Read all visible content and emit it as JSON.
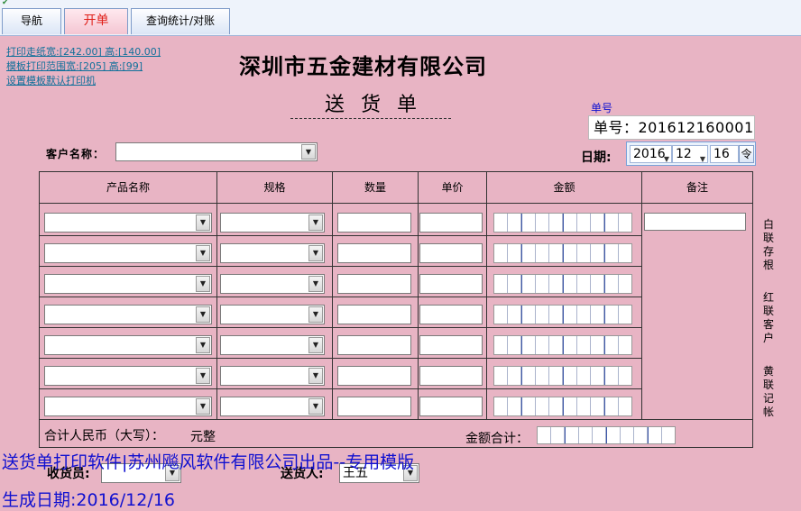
{
  "tabs": [
    {
      "label": "导航",
      "active": false
    },
    {
      "label": "开单",
      "active": true
    },
    {
      "label": "查询统计/对账",
      "active": false
    }
  ],
  "links": {
    "print_paper": "打印走纸宽:[242.00] 高:[140.00]",
    "print_range": "模板打印范围宽:[205] 高:[99]",
    "default_printer": "设置模板默认打印机"
  },
  "company_name": "深圳市五金建材有限公司",
  "document_title": "送货单",
  "order": {
    "caption": "单号",
    "value": "单号：201612160001"
  },
  "date": {
    "label": "日期:",
    "year": "2016",
    "month": "12",
    "day": "16",
    "calendar_glyph": "令"
  },
  "customer": {
    "label": "客户名称：",
    "value": ""
  },
  "table": {
    "headers": [
      "产品名称",
      "规格",
      "数量",
      "单价",
      "金额",
      "备注"
    ],
    "row_count": 7
  },
  "totals": {
    "uppercase_label": "合计人民币（大写）：",
    "yuan_suffix": "元整",
    "sum_label": "金额合计："
  },
  "copies": {
    "white": "白联存根",
    "red": "红联客户",
    "yellow": "黄联记帐"
  },
  "footer": {
    "brand": "送货单打印软件|苏州飚风软件有限公司出品--专用模版",
    "receiver_label": "收货员:",
    "receiver_value": "",
    "sender_label": "送货人:",
    "sender_value": "王五",
    "generated": "生成日期:2016/12/16"
  },
  "colors": {
    "background": "#e8b4c4",
    "brand_text": "#1010d0",
    "active_tab_text": "#e0201a"
  }
}
